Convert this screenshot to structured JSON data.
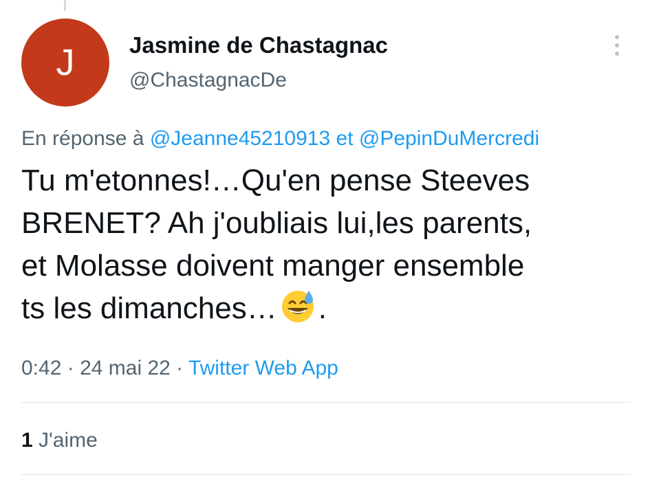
{
  "author": {
    "avatar_initial": "J",
    "avatar_color": "#c23a1b",
    "display_name": "Jasmine de Chastagnac",
    "handle": "@ChastagnacDe"
  },
  "more_icon": "more-vertical-icon",
  "reply": {
    "prefix": "En réponse à",
    "mention_1": "@Jeanne45210913",
    "conjunction": "et",
    "mention_2": "@PepinDuMercredi"
  },
  "tweet": {
    "text_line_1": "Tu m'etonnes!…Qu'en pense Steeves",
    "text_line_2": "BRENET? Ah j'oubliais lui,les parents,",
    "text_line_3": "et Molasse doivent manger ensemble",
    "text_line_4": "ts les dimanches…",
    "emoji": "grinning-face-with-sweat-icon",
    "text_end": "."
  },
  "meta": {
    "time": "0:42",
    "separator": "·",
    "date": "24 mai 22",
    "source": "Twitter Web App"
  },
  "likes": {
    "count": "1",
    "label": "J'aime"
  },
  "colors": {
    "link": "#1d9bf0",
    "secondary_text": "#536471",
    "primary_text": "#0f1419"
  }
}
